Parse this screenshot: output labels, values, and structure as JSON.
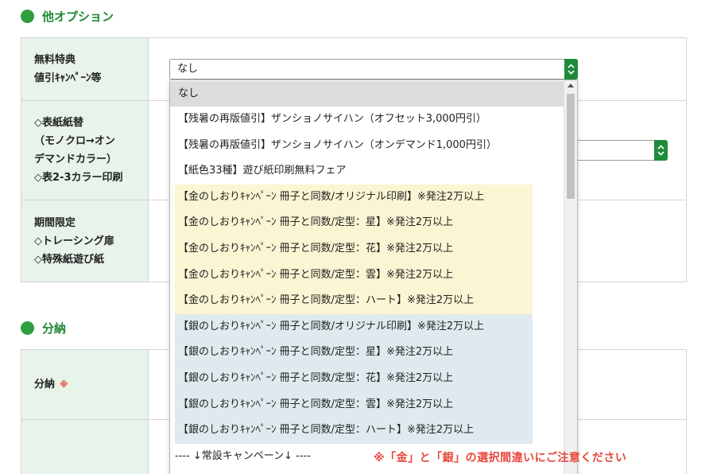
{
  "sections": {
    "other_options": {
      "title": "他オプション"
    },
    "installment": {
      "title": "分納"
    }
  },
  "rows": {
    "campaign": {
      "label_line1": "無料特典",
      "label_line2": "値引ｷｬﾝﾍﾟｰﾝ等"
    },
    "cover": {
      "line1": "◇表紙紙替",
      "line2": "（モノクロ→オン",
      "line3": "デマンドカラー）",
      "line4": "◇表2-3カラー印刷"
    },
    "limited": {
      "line1": "期間限定",
      "line2": "◇トレーシング扉",
      "line3": "◇特殊紙遊び紙"
    },
    "installment": {
      "label": "分納",
      "required_mark": "※"
    }
  },
  "campaign_select": {
    "selected": "なし"
  },
  "dropdown_options": [
    "なし",
    "【残暑の再版値引】ザンショノサイハン（オフセット3,000円引）",
    "【残暑の再版値引】ザンショノサイハン（オンデマンド1,000円引）",
    "【紙色33種】遊び紙印刷無料フェア",
    "【金のしおりｷｬﾝﾍﾟｰﾝ 冊子と同数/オリジナル印刷】※発注2万以上",
    "【金のしおりｷｬﾝﾍﾟｰﾝ 冊子と同数/定型：星】※発注2万以上",
    "【金のしおりｷｬﾝﾍﾟｰﾝ 冊子と同数/定型：花】※発注2万以上",
    "【金のしおりｷｬﾝﾍﾟｰﾝ 冊子と同数/定型：雲】※発注2万以上",
    "【金のしおりｷｬﾝﾍﾟｰﾝ 冊子と同数/定型：ハート】※発注2万以上",
    "【銀のしおりｷｬﾝﾍﾟｰﾝ 冊子と同数/オリジナル印刷】※発注2万以上",
    "【銀のしおりｷｬﾝﾍﾟｰﾝ 冊子と同数/定型：星】※発注2万以上",
    "【銀のしおりｷｬﾝﾍﾟｰﾝ 冊子と同数/定型：花】※発注2万以上",
    "【銀のしおりｷｬﾝﾍﾟｰﾝ 冊子と同数/定型：雲】※発注2万以上",
    "【銀のしおりｷｬﾝﾍﾟｰﾝ 冊子と同数/定型：ハート】※発注2万以上",
    "---- ↓常設キャンペーン↓ ----"
  ],
  "warning": "※「金」と「銀」の選択間違いにご注意ください",
  "colors": {
    "brand_green": "#1e8b3a",
    "header_bg": "#e8f4ea",
    "gold_bg": "#fbf5d3",
    "silver_bg": "#dfeaef",
    "warning_red": "#e8463a"
  }
}
